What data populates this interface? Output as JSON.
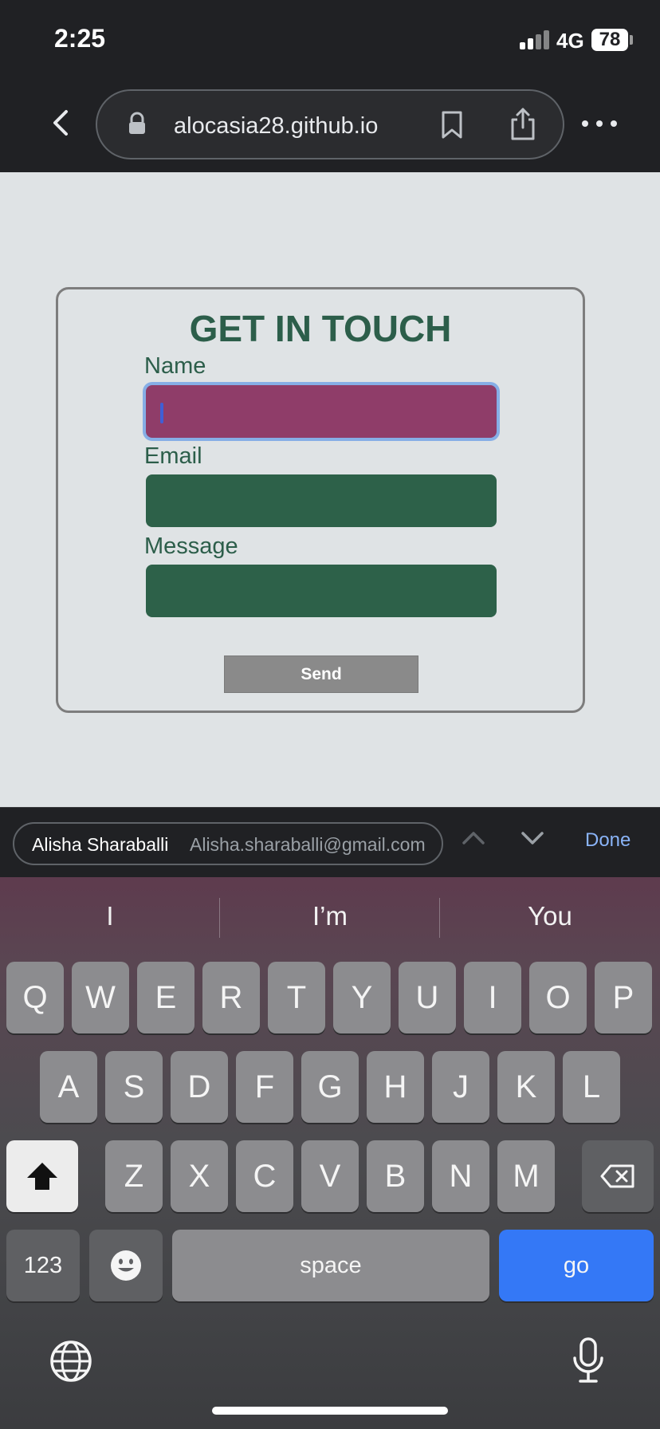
{
  "status_bar": {
    "time": "2:25",
    "network": "4G",
    "battery": "78"
  },
  "browser": {
    "url": "alocasia28.github.io"
  },
  "form": {
    "title": "GET IN TOUCH",
    "name_label": "Name",
    "email_label": "Email",
    "message_label": "Message",
    "send_label": "Send",
    "colors": {
      "field": "#2d6149",
      "active_field": "#8f3d69",
      "heading": "#2c5e4a"
    }
  },
  "autofill": {
    "name": "Alisha Sharaballi",
    "email": "Alisha.sharaballi@gmail.com",
    "done_label": "Done"
  },
  "keyboard": {
    "predictions": [
      "I",
      "I’m",
      "You"
    ],
    "row1": [
      "Q",
      "W",
      "E",
      "R",
      "T",
      "Y",
      "U",
      "I",
      "O",
      "P"
    ],
    "row2": [
      "A",
      "S",
      "D",
      "F",
      "G",
      "H",
      "J",
      "K",
      "L"
    ],
    "row3": [
      "Z",
      "X",
      "C",
      "V",
      "B",
      "N",
      "M"
    ],
    "numbers_label": "123",
    "space_label": "space",
    "go_label": "go",
    "icons": [
      "shift-icon",
      "backspace-icon",
      "emoji-icon",
      "globe-icon",
      "microphone-icon"
    ]
  }
}
